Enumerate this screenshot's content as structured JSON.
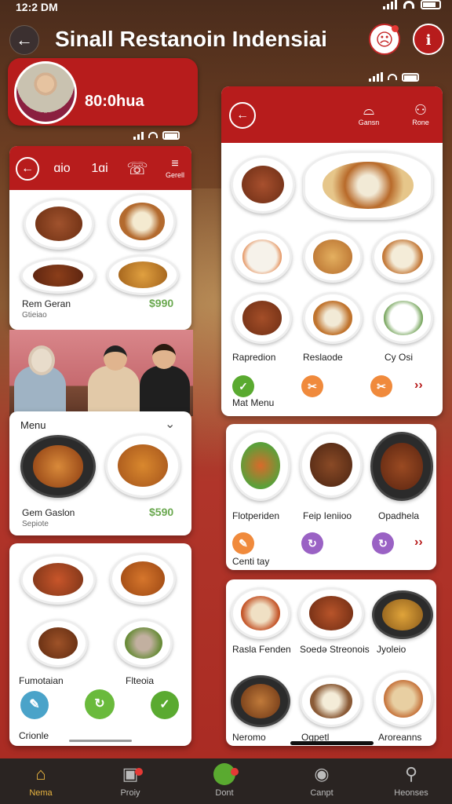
{
  "status": {
    "time": "12:2 DM"
  },
  "header": {
    "title": "Sinall Restanoin Indensiai"
  },
  "profile": {
    "time": "80:0hua"
  },
  "left_panel_top": {
    "bar_items": [
      "ɑio",
      "1ɑi",
      "☏",
      "≡"
    ],
    "bar_sub": "Gerell",
    "item_title": "Rem Geran",
    "item_sub": "Gtieiao",
    "price": "$990"
  },
  "left_panel_menu": {
    "heading": "Menu",
    "item_title": "Gem Gaslon",
    "item_sub": "Sepiote",
    "price": "$590"
  },
  "left_panel_bottom": {
    "label1": "Fumotaian",
    "label2": "Flteoia",
    "footer": "Crionle"
  },
  "right_panel": {
    "bar_items": [
      {
        "icon": "bowl-icon",
        "label": "Gansn"
      },
      {
        "icon": "people-icon",
        "label": "Rone"
      }
    ],
    "section1": {
      "labels": [
        "Rapredion",
        "Reslaode",
        "Cy Osi"
      ],
      "footer": "Mat Menu"
    },
    "section2": {
      "labels": [
        "Flotperiden",
        "Feip Ieniioo",
        "Opadhela"
      ],
      "footer": "Centi tay"
    },
    "section3": {
      "labels": [
        "Rasla Fenden",
        "Soedə Streonois",
        "Jyoleio"
      ],
      "labels2": [
        "Neromo",
        "Ogpetl",
        "Aroreanns"
      ]
    }
  },
  "tabs": [
    {
      "label": "Nema",
      "icon": "home-icon",
      "active": true
    },
    {
      "label": "Proiy",
      "icon": "bag-icon",
      "active": false
    },
    {
      "label": "Dont",
      "icon": "cart-icon",
      "active": false
    },
    {
      "label": "Canpt",
      "icon": "compass-icon",
      "active": false
    },
    {
      "label": "Heonses",
      "icon": "profile-icon",
      "active": false
    }
  ],
  "colors": {
    "accent": "#b71c1c",
    "price": "#6aa84f",
    "tab_active": "#e8b440"
  }
}
